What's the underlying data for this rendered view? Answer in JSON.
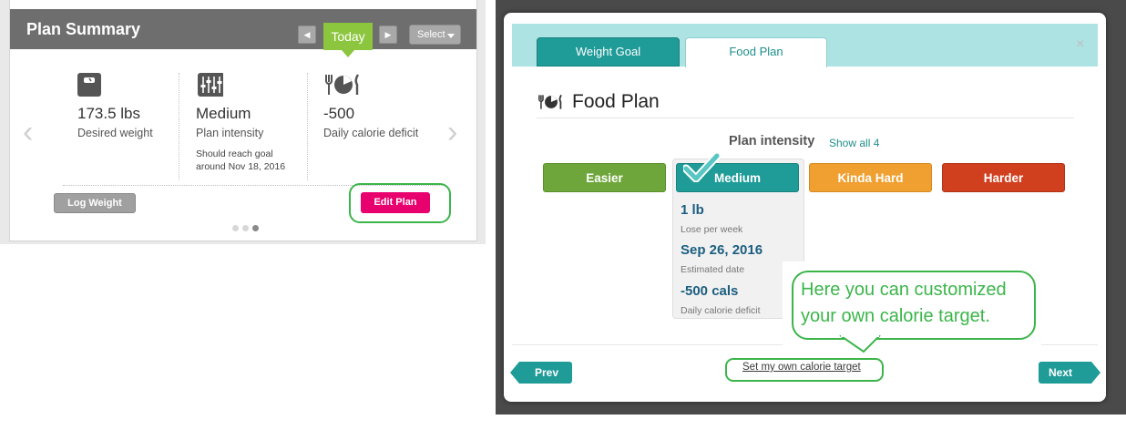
{
  "plan_summary": {
    "title": "Plan Summary",
    "today_label": "Today",
    "select_label": "Select",
    "stats": [
      {
        "icon": "scale-icon",
        "value": "173.5 lbs",
        "label": "Desired weight"
      },
      {
        "icon": "sliders-icon",
        "value": "Medium",
        "label": "Plan intensity",
        "note_line1": "Should reach goal",
        "note_line2": "around Nov 18, 2016"
      },
      {
        "icon": "food-plate-icon",
        "value": "-500",
        "label": "Daily calorie deficit"
      }
    ],
    "log_weight_label": "Log Weight",
    "edit_plan_label": "Edit Plan"
  },
  "modal": {
    "tabs": [
      {
        "label": "Weight Goal",
        "active": false
      },
      {
        "label": "Food Plan",
        "active": true
      }
    ],
    "close_glyph": "×",
    "section_title": "Food Plan",
    "plan_intensity_label": "Plan intensity",
    "show_all_label": "Show all 4",
    "intensity_options": [
      "Easier",
      "Medium",
      "Kinda Hard",
      "Harder"
    ],
    "selected_intensity": "Medium",
    "selected_detail": {
      "rate_value": "1 lb",
      "rate_label": "Lose per week",
      "date_value": "Sep 26, 2016",
      "date_label": "Estimated date",
      "deficit_value": "-500 cals",
      "deficit_label": "Daily calorie deficit"
    },
    "prev_label": "Prev",
    "next_label": "Next",
    "custom_target_link": "Set my own calorie target"
  },
  "callout": {
    "line1": "Here you can customized",
    "line2": "your own calorie target."
  },
  "colors": {
    "teal": "#1f9b98",
    "easier": "#6fa63b",
    "kinda_hard": "#f0a030",
    "harder": "#d0401f",
    "edit_plan": "#e8006f",
    "today": "#8cc63f",
    "annotation_green": "#3bb54a"
  }
}
